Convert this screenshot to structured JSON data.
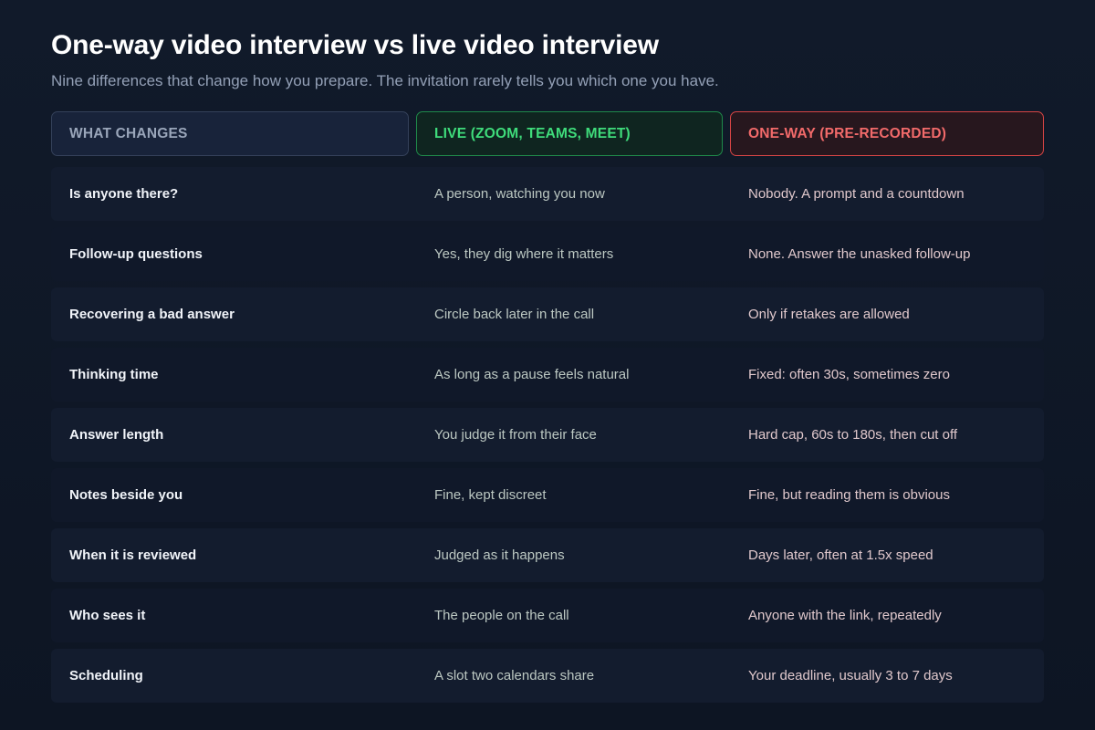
{
  "title": "One-way video interview vs live video interview",
  "subtitle": "Nine differences that change how you prepare. The invitation rarely tells you which one you have.",
  "headers": {
    "what": "WHAT CHANGES",
    "live": "LIVE (ZOOM, TEAMS, MEET)",
    "oneway": "ONE-WAY (PRE-RECORDED)"
  },
  "colors": {
    "live_accent": "#3fdc7b",
    "oneway_accent": "#f26a6a"
  },
  "rows": [
    {
      "what": "Is anyone there?",
      "live": "A person, watching you now",
      "oneway": "Nobody. A prompt and a countdown"
    },
    {
      "what": "Follow-up questions",
      "live": "Yes, they dig where it matters",
      "oneway": "None. Answer the unasked follow-up"
    },
    {
      "what": "Recovering a bad answer",
      "live": "Circle back later in the call",
      "oneway": "Only if retakes are allowed"
    },
    {
      "what": "Thinking time",
      "live": "As long as a pause feels natural",
      "oneway": "Fixed: often 30s, sometimes zero"
    },
    {
      "what": "Answer length",
      "live": "You judge it from their face",
      "oneway": "Hard cap, 60s to 180s, then cut off"
    },
    {
      "what": "Notes beside you",
      "live": "Fine, kept discreet",
      "oneway": "Fine, but reading them is obvious"
    },
    {
      "what": "When it is reviewed",
      "live": "Judged as it happens",
      "oneway": "Days later, often at 1.5x speed"
    },
    {
      "what": "Who sees it",
      "live": "The people on the call",
      "oneway": "Anyone with the link, repeatedly"
    },
    {
      "what": "Scheduling",
      "live": "A slot two calendars share",
      "oneway": "Your deadline, usually 3 to 7 days"
    }
  ]
}
